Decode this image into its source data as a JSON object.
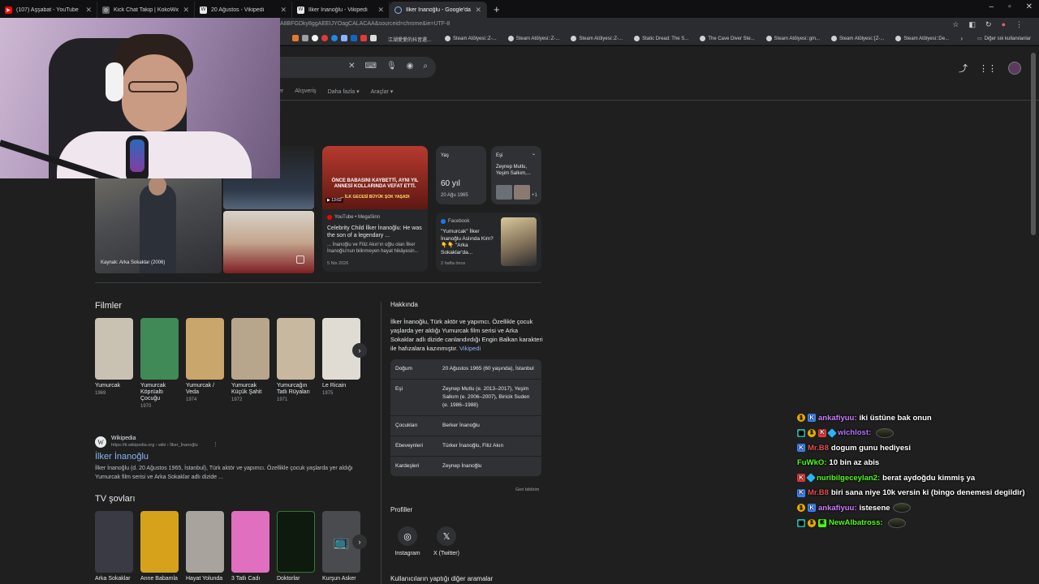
{
  "tabs": [
    {
      "label": "(107) Aşşabat - YouTube",
      "icon": "youtube-icon",
      "color": "#ff0000"
    },
    {
      "label": "Kick Chat Takip | KokoWich",
      "icon": "globe-icon",
      "color": "#5f6368"
    },
    {
      "label": "20 Ağustos - Vikipedi",
      "icon": "wikipedia-icon",
      "color": "#e8eaed"
    },
    {
      "label": "İlker İnanoğlu - Vikipedi",
      "icon": "wikipedia-icon",
      "color": "#e8eaed"
    },
    {
      "label": "İlker İnanoğlu - Google'da Ara",
      "icon": "loading-icon",
      "color": "#8ab4f8",
      "active": true
    }
  ],
  "address": {
    "url": "A8BFGDky8ggAEEIJYOagCALACAA&sourceid=chrome&ie=UTF-8"
  },
  "bookmarks": {
    "cjk_label": "江湖愛愛的抖音還...",
    "items": [
      "Steam Atölyesi::Z-...",
      "Steam Atölyesi::Z-...",
      "Steam Atölyesi::Z-...",
      "Static Dread: The S...",
      "The Cave Diver Ste...",
      "Steam Atölyesi::gm...",
      "Steam Atölyesi::[Z-...",
      "Steam Atölyesi::De..."
    ],
    "other": "Diğer sık kullanılanlar"
  },
  "search": {
    "nav_tabs": [
      "er",
      "Alışveriş",
      "Daha fazla",
      "Araçlar"
    ]
  },
  "images": {
    "caption": "Kaynak: Arka Sokaklar (2006)"
  },
  "yt_card": {
    "headline": "ÖNCE BABASINI KAYBETTİ, AYNI YIL ANNESİ KOLLARINDA VEFAT ETTİ.",
    "headline2": "... İLK GECESİ BÜYÜK ŞOK YAŞADI",
    "duration": "13:02",
    "source": "YouTube • MegaSinn",
    "title": "Celebrity Child İlker İnanoğlu: He was the son of a legendary ...",
    "snippet": "... İnanoğlu ve Filiz Akın'ın oğlu olan İlker İnanoğlu'nun bilinmeyen hayat hikâyesin...",
    "date": "5 Nis 2026"
  },
  "age_card": {
    "label": "Yaş",
    "value": "60 yıl",
    "date": "20 Ağu 1965"
  },
  "spouse_card": {
    "label": "Eşi",
    "value": "Zeynep Mutlu, Yeşim Salkım,...",
    "more": "+1"
  },
  "fb_card": {
    "source": "Facebook",
    "title": "\"Yumurcak\" İlker İnanoğlu Aslında Kim? 👇👇 \"Arka Sokaklar'da...",
    "date": "2 hafta önce"
  },
  "films": {
    "title": "Filmler",
    "items": [
      {
        "name": "Yumurcak",
        "year": "1969",
        "color": "#c9c2b3"
      },
      {
        "name": "Yumurcak Köprüaltı Çocuğu",
        "year": "1970",
        "color": "#3f8a57"
      },
      {
        "name": "Yumurcak / Veda",
        "year": "1974",
        "color": "#c9a66b"
      },
      {
        "name": "Yumurcak Küçük Şahit",
        "year": "1972",
        "color": "#b7a58c"
      },
      {
        "name": "Yumurcağın Tatlı Rüyaları",
        "year": "1971",
        "color": "#c8b8a0"
      },
      {
        "name": "Le Ricain",
        "year": "1975",
        "color": "#e0dcd4"
      }
    ]
  },
  "wiki": {
    "site": "Wikipedia",
    "url": "https://tr.wikipedia.org › wiki › İlker_İnanoğlu",
    "title": "İlker İnanoğlu",
    "snippet": "İlker İnanoğlu (d. 20 Ağustos 1965, İstanbul), Türk aktör ve yapımcı. Özellikle çocuk yaşlarda yer aldığı Yumurcak film serisi ve Arka Sokaklar adlı dizide ..."
  },
  "tv": {
    "title": "TV şovları",
    "items": [
      {
        "name": "Arka Sokaklar",
        "color": "#3a3a44"
      },
      {
        "name": "Anne Babamla",
        "color": "#d6a21b"
      },
      {
        "name": "Hayat Yolunda",
        "color": "#a8a39c"
      },
      {
        "name": "3 Tatlı Cadı",
        "color": "#e06fc0"
      },
      {
        "name": "Doktorlar",
        "color": "#0d1a0d"
      },
      {
        "name": "Kurşun Asker",
        "color": "#4a4b4e"
      }
    ]
  },
  "about": {
    "title": "Hakkında",
    "text": "İlker İnanoğlu, Türk aktör ve yapımcı. Özellikle çocuk yaşlarda yer aldığı Yumurcak film serisi ve Arka Sokaklar adlı dizide canlandırdığı Engin Balkan karakteri ile hafızalara kazınmıştır.",
    "link": "Vikipedi",
    "facts": [
      {
        "k": "Doğum",
        "v": "20 Ağustos 1965 (60 yaşında), İstanbul"
      },
      {
        "k": "Eşi",
        "v": "Zeynep Mutlu (e. 2013–2017), Yeşim Salkım (e. 2006–2007), Biricik Suden (e. 1986–1988)"
      },
      {
        "k": "Çocukları",
        "v": "Berker İnanoğlu"
      },
      {
        "k": "Ebeveynleri",
        "v": "Türker İnanoğlu, Filiz Akın"
      },
      {
        "k": "Kardeşleri",
        "v": "Zeynep İnanoğlu"
      }
    ],
    "feedback": "Geri bildirim"
  },
  "profiles": {
    "title": "Profiller",
    "items": [
      {
        "name": "Instagram"
      },
      {
        "name": "X (Twitter)"
      }
    ]
  },
  "others": {
    "title": "Kullanıcıların yaptığı diğer aramalar"
  },
  "chat": [
    {
      "user": "ankafiyuu:",
      "color": "#d07cff",
      "badges": [
        "one",
        "k"
      ],
      "msg": "iki üstüne bak onun",
      "emote": false
    },
    {
      "user": "wichlost:",
      "color": "#b073ff",
      "badges": [
        "multi",
        "one",
        "kr",
        "gem"
      ],
      "msg": "",
      "emote": true
    },
    {
      "user": "Mr.B8",
      "color": "#e05050",
      "badges": [
        "k"
      ],
      "msg": "dogum gunu hediyesi",
      "emote": false
    },
    {
      "user": "FuWkO:",
      "color": "#53fc18",
      "badges": [],
      "msg": "10 bin az abis",
      "emote": false
    },
    {
      "user": "nuribilgeceylan2:",
      "color": "#53fc18",
      "badges": [
        "kr",
        "gem"
      ],
      "msg": "berat aydoğdu kimmiş ya",
      "emote": false
    },
    {
      "user": "Mr.B8",
      "color": "#e05050",
      "badges": [
        "k"
      ],
      "msg": "biri sana niye 10k versin ki (bingo denemesi degildir)",
      "emote": false
    },
    {
      "user": "ankafiyuu:",
      "color": "#d07cff",
      "badges": [
        "one",
        "k"
      ],
      "msg": "istesene",
      "emote": true
    },
    {
      "user": "NewAlbatross:",
      "color": "#53fc18",
      "badges": [
        "multi",
        "one",
        "kg"
      ],
      "msg": "",
      "emote": true
    }
  ]
}
